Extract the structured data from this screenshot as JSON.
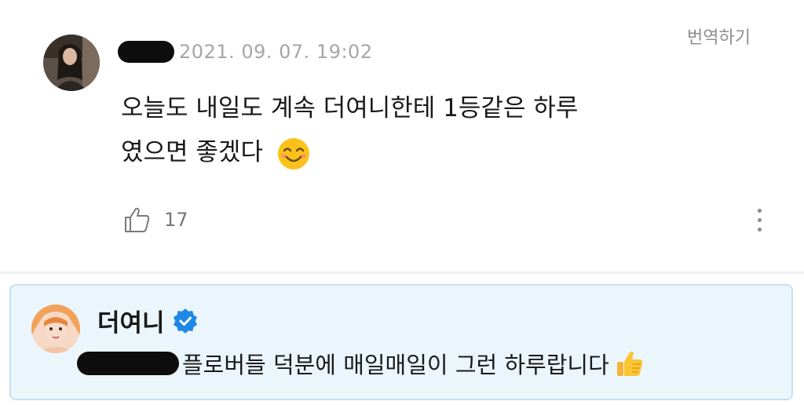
{
  "comment": {
    "timestamp": "2021. 09. 07. 19:02",
    "translate_label": "번역하기",
    "text_line1": "오늘도 내일도 계속 더여니한테 1등같은 하루",
    "text_line2": "였으면 좋겠다",
    "emoji": "smiling-face-icon",
    "like_count": "17"
  },
  "reply": {
    "author": "더여니",
    "text": "플로버들 덕분에 매일매일이 그런 하루랍니다",
    "emoji": "thumbs-up-icon"
  },
  "colors": {
    "reply_background": "#ebf5fc",
    "reply_border": "#c9dff0",
    "verified_blue": "#1e88e5",
    "timestamp_gray": "#a6a6a6"
  }
}
